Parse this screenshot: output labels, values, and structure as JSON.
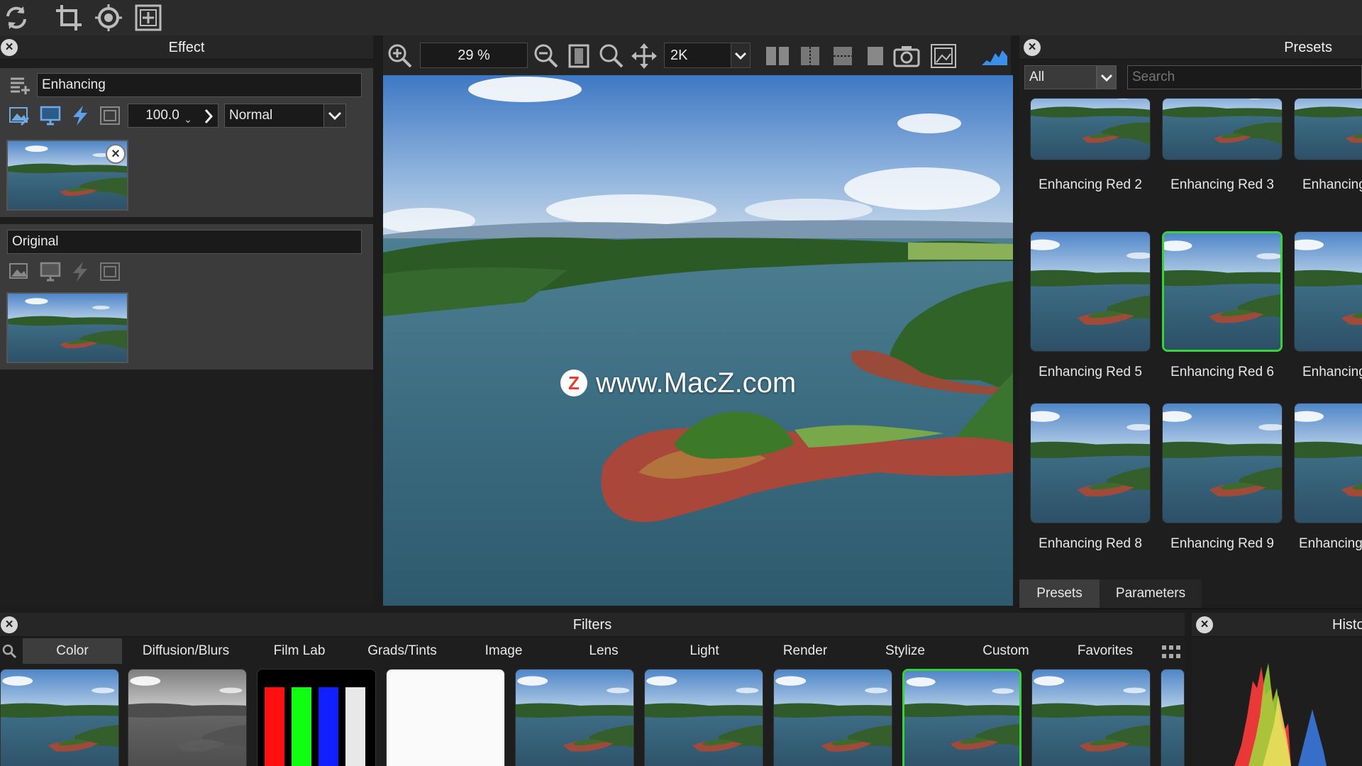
{
  "toolbar": {
    "icons": [
      "refresh-icon",
      "crop-icon",
      "focus-icon",
      "add-frame-icon"
    ]
  },
  "effect_panel": {
    "title": "Effect",
    "layers": [
      {
        "name": "Enhancing",
        "opacity": "100.0",
        "blend_mode": "Normal"
      },
      {
        "name": "Original"
      }
    ]
  },
  "viewer": {
    "zoom": "29 %",
    "resolution": "2K",
    "watermark": "www.MacZ.com",
    "watermark_logo": "Z"
  },
  "presets_panel": {
    "title": "Presets",
    "category": "All",
    "search_placeholder": "Search",
    "items": [
      {
        "label": "Enhancing Red 2"
      },
      {
        "label": "Enhancing Red 3"
      },
      {
        "label": "Enhancing"
      },
      {
        "label": "Enhancing Red 5"
      },
      {
        "label": "Enhancing Red 6",
        "selected": true
      },
      {
        "label": "Enhancing"
      },
      {
        "label": "Enhancing Red 8"
      },
      {
        "label": "Enhancing Red 9"
      },
      {
        "label": "Enhancing"
      }
    ],
    "tabs": [
      "Presets",
      "Parameters"
    ],
    "active_tab": "Presets"
  },
  "filters_panel": {
    "title": "Filters",
    "tabs": [
      "Color",
      "Diffusion/Blurs",
      "Film Lab",
      "Grads/Tints",
      "Image",
      "Lens",
      "Light",
      "Render",
      "Stylize",
      "Custom",
      "Favorites"
    ],
    "active_tab": "Color"
  },
  "histogram_panel": {
    "title": "Histo"
  },
  "colors": {
    "accent_selected": "#3ad13a",
    "panel_bg": "#1e1e1e",
    "header_bg": "#262626"
  }
}
